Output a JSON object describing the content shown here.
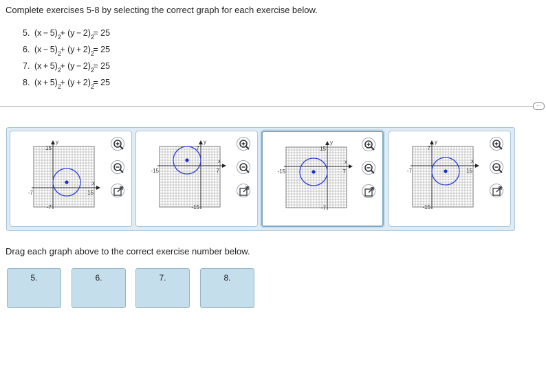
{
  "instructions": "Complete exercises 5-8 by selecting the correct graph for each exercise below.",
  "exercises": [
    {
      "num": "5.",
      "p1": "(x − 5)",
      "p2": " + (y − 2)",
      "p3": " = 25"
    },
    {
      "num": "6.",
      "p1": "(x − 5)",
      "p2": " + (y + 2)",
      "p3": " = 25"
    },
    {
      "num": "7.",
      "p1": "(x + 5)",
      "p2": " + (y − 2)",
      "p3": " = 25"
    },
    {
      "num": "8.",
      "p1": "(x + 5)",
      "p2": " + (y + 2)",
      "p3": " = 25"
    }
  ],
  "more_icon": "ellipsis-icon",
  "graphs": [
    {
      "top": "15",
      "bottom": "-7",
      "left": "-7",
      "right": "15",
      "x_label": "x",
      "y_label": "y",
      "center": [
        5,
        2
      ],
      "radius": 5,
      "xlim": [
        -7,
        15
      ],
      "ylim": [
        -7,
        15
      ]
    },
    {
      "top": "7",
      "bottom": "-15",
      "left": "-15",
      "right": "7",
      "x_label": "x",
      "y_label": "y",
      "center": [
        -5,
        2
      ],
      "radius": 5,
      "xlim": [
        -15,
        7
      ],
      "ylim": [
        -15,
        7
      ]
    },
    {
      "top": "15",
      "bottom": "-7",
      "left": "-15",
      "right": "7",
      "x_label": "x",
      "y_label": "y",
      "center": [
        -5,
        -2
      ],
      "radius": 5,
      "xlim": [
        -15,
        7
      ],
      "ylim": [
        -15,
        7
      ]
    },
    {
      "top": "7",
      "bottom": "-15",
      "left": "-7",
      "right": "15",
      "x_label": "x",
      "y_label": "y",
      "center": [
        5,
        -2
      ],
      "radius": 5,
      "xlim": [
        -7,
        15
      ],
      "ylim": [
        -15,
        7
      ]
    }
  ],
  "tools": [
    "zoom-in-icon",
    "zoom-out-icon",
    "expand-icon"
  ],
  "drag_note": "Drag each graph above to the correct exercise number below.",
  "drop_targets": [
    "5.",
    "6.",
    "7.",
    "8."
  ],
  "colors": {
    "circle": "#2a3fd4",
    "point": "#1a2ecc",
    "tray": "#e0ecf5",
    "drop": "#c4dfeb"
  }
}
